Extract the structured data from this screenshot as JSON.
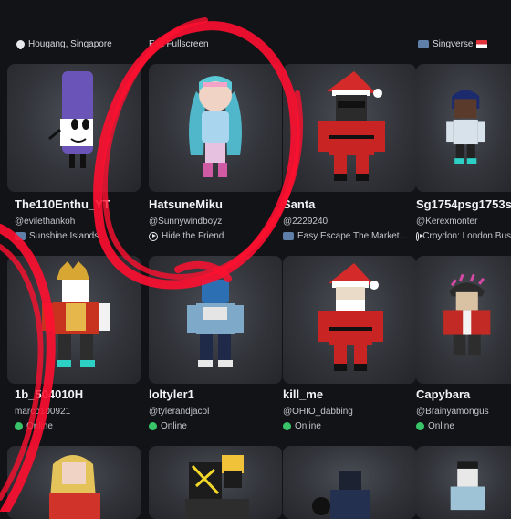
{
  "top_labels": {
    "col0": "Hougang, Singapore",
    "col1": "Exit Fullscreen",
    "col3": "Singverse"
  },
  "row1": [
    {
      "name": "The110Enthu",
      "name_suffix": "YT",
      "handle": "@evilethankoh",
      "status": "Sunshine Islands"
    },
    {
      "name": "HatsuneMiku",
      "handle": "@Sunnywindboyz",
      "status": "Hide the Friend"
    },
    {
      "name": "Santa",
      "handle": "@2229240",
      "status": "Easy Escape The Market..."
    },
    {
      "name": "Sg1754psg1753s",
      "handle": "@Kerexmonter",
      "status": "Croydon: London Bus"
    }
  ],
  "row2": [
    {
      "name": "1b_504010H",
      "handle": "marco100921",
      "status": "Online"
    },
    {
      "name": "loltyler1",
      "handle": "@tylerandjacol",
      "status": "Online"
    },
    {
      "name": "kill_me",
      "handle": "@OHIO_dabbing",
      "status": "Online"
    },
    {
      "name": "Capybara",
      "handle": "@Brainyamongus",
      "status": "Online"
    }
  ],
  "colors": {
    "background": "#121317",
    "online": "#39c46a",
    "scribble": "#ff1030"
  }
}
